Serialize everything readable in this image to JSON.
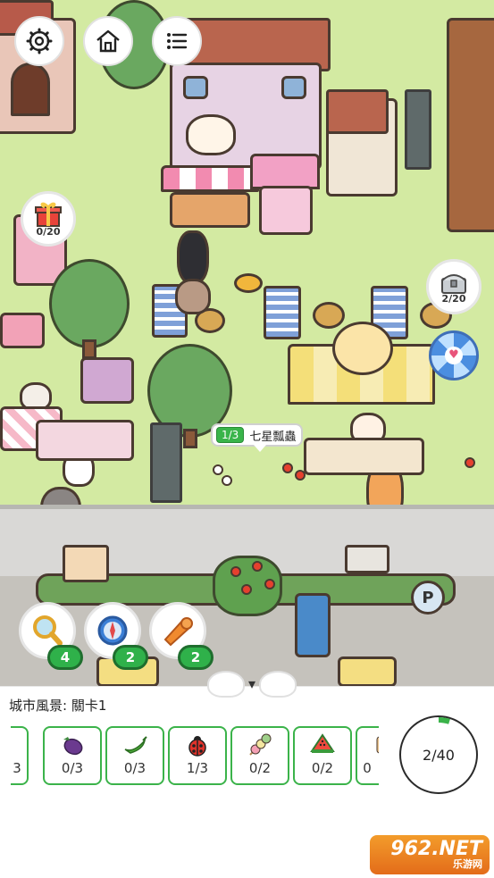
{
  "top_buttons": {
    "settings_icon": "gear-icon",
    "home_icon": "house-icon",
    "menu_icon": "list-icon"
  },
  "side_badges": {
    "gift": {
      "icon": "gift-box-icon",
      "count": "0/20"
    },
    "chest": {
      "icon": "treasure-chest-icon",
      "count": "2/20"
    },
    "wheel": {
      "icon": "lucky-wheel-icon"
    }
  },
  "hint_tooltip": {
    "progress": "1/3",
    "label": "七星瓢蟲"
  },
  "tools": [
    {
      "name": "magnifier",
      "icon": "magnifier-icon",
      "count": "4"
    },
    {
      "name": "compass",
      "icon": "compass-icon",
      "count": "2"
    },
    {
      "name": "horn",
      "icon": "horn-icon",
      "count": "2"
    }
  ],
  "panel": {
    "level_title": "城市風景: 關卡1",
    "collapse_icon": "chevron-down-icon",
    "items": [
      {
        "icon": "partial-item-icon",
        "progress": "3"
      },
      {
        "icon": "eggplant-icon",
        "progress": "0/3"
      },
      {
        "icon": "chili-pepper-icon",
        "progress": "0/3"
      },
      {
        "icon": "ladybug-icon",
        "progress": "1/3"
      },
      {
        "icon": "skewer-icon",
        "progress": "0/2"
      },
      {
        "icon": "watermelon-icon",
        "progress": "0/2"
      },
      {
        "icon": "partial-item-icon",
        "progress": "0"
      }
    ],
    "total_progress": {
      "text": "2/40",
      "fraction": 0.05
    }
  },
  "watermark": {
    "main": "962.NET",
    "sub": "乐游网"
  },
  "colors": {
    "accent_green": "#2fb14a",
    "grass": "#d3eaa2",
    "wood": "#4a3a30"
  }
}
